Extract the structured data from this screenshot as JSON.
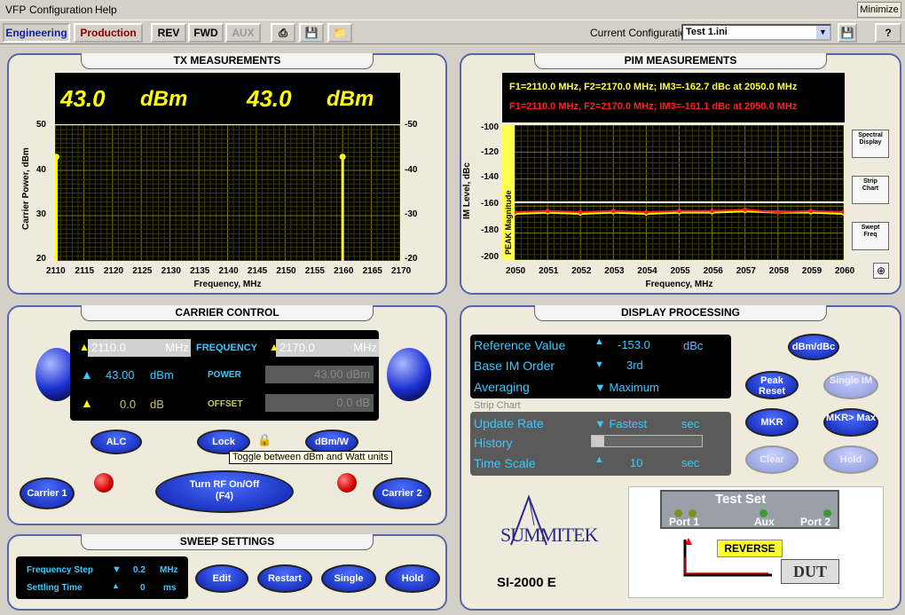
{
  "menu": {
    "items": [
      "VFP",
      "Configuration",
      "Help"
    ],
    "minimize": "Minimize"
  },
  "toolbar": {
    "engineering": "Engineering",
    "production": "Production",
    "rev": "REV",
    "fwd": "FWD",
    "aux": "AUX",
    "config_label": "Current Configuration:",
    "config_value": "Test 1.ini",
    "help": "?"
  },
  "tx": {
    "title": "TX MEASUREMENTS",
    "readout_left_value": "43.0",
    "readout_left_unit": "dBm",
    "readout_right_value": "43.0",
    "readout_right_unit": "dBm",
    "ylabel": "Carrier Power, dBm",
    "xlabel": "Frequency, MHz",
    "yticks": [
      "50",
      "40",
      "30",
      "20"
    ],
    "yticks_right": [
      "-50",
      "-40",
      "-30",
      "-20"
    ],
    "xticks": [
      "2110",
      "2115",
      "2120",
      "2125",
      "2130",
      "2135",
      "2140",
      "2145",
      "2150",
      "2155",
      "2160",
      "2165",
      "2170"
    ]
  },
  "pim": {
    "title": "PIM MEASUREMENTS",
    "line1": "F1=2110.0 MHz, F2=2170.0 MHz;  IM3=-162.7 dBc at 2050.0 MHz",
    "line2": "F1=2110.0 MHz, F2=2170.0 MHz;  IM3=-161.1 dBc at 2050.0 MHz",
    "ylabel": "IM Level, dBc",
    "xlabel": "Frequency, MHz",
    "peak_label": "PEAK Magnitude",
    "yticks": [
      "-100",
      "-120",
      "-140",
      "-160",
      "-180",
      "-200"
    ],
    "xticks": [
      "2050",
      "2051",
      "2052",
      "2053",
      "2054",
      "2055",
      "2056",
      "2057",
      "2058",
      "2059",
      "2060"
    ],
    "modes": [
      "Spectral Display",
      "Strip Chart",
      "Swept Freq"
    ]
  },
  "chart_data": [
    {
      "type": "bar",
      "title": "TX MEASUREMENTS",
      "xlabel": "Frequency, MHz",
      "ylabel": "Carrier Power, dBm",
      "x": [
        2110,
        2160
      ],
      "values": [
        43.0,
        43.0
      ],
      "xlim": [
        2110,
        2170
      ],
      "ylim": [
        20,
        50
      ],
      "grid": true
    },
    {
      "type": "line",
      "title": "PIM MEASUREMENTS",
      "xlabel": "Frequency, MHz",
      "ylabel": "IM Level, dBc",
      "xlim": [
        2050,
        2060
      ],
      "ylim": [
        -200,
        -90
      ],
      "grid": true,
      "series": [
        {
          "color": "#ffff00",
          "x": [
            2050,
            2051,
            2052,
            2053,
            2054,
            2055,
            2056,
            2057,
            2058,
            2059,
            2060
          ],
          "values": [
            -162,
            -161,
            -162,
            -161,
            -162,
            -161,
            -161,
            -160,
            -161,
            -161,
            -162
          ]
        },
        {
          "color": "#ff2020",
          "x": [
            2050,
            2051,
            2052,
            2053,
            2054,
            2055,
            2056,
            2057,
            2058,
            2059,
            2060
          ],
          "values": [
            -161,
            -160,
            -161,
            -160,
            -161,
            -160,
            -160,
            -159,
            -161,
            -160,
            -161
          ]
        }
      ]
    }
  ],
  "carrier": {
    "title": "CARRIER CONTROL",
    "f1": "2110.0",
    "f2": "2170.0",
    "mhz": "MHz",
    "frequency": "FREQUENCY",
    "p1": "43.00",
    "p2": "43.00",
    "dbm": "dBm",
    "power": "POWER",
    "o1": "0.0",
    "o2": "0.0",
    "db": "dB",
    "offset": "OFFSET",
    "alc": "ALC",
    "lock": "Lock",
    "dbmw": "dBm/W",
    "tooltip": "Toggle between dBm and Watt units",
    "carrier1": "Carrier 1",
    "carrier2": "Carrier 2",
    "rf1": "Turn RF On/Off",
    "rf2": "(F4)"
  },
  "sweep": {
    "title": "SWEEP SETTINGS",
    "step_label": "Frequency Step",
    "step_value": "0.2",
    "step_unit": "MHz",
    "settle_label": "Settling Time",
    "settle_value": "0",
    "settle_unit": "ms",
    "edit": "Edit",
    "restart": "Restart",
    "single": "Single",
    "hold": "Hold"
  },
  "display": {
    "title": "DISPLAY PROCESSING",
    "ref_label": "Reference Value",
    "ref_value": "-153.0",
    "ref_unit": "dBc",
    "order_label": "Base IM Order",
    "order_value": "3rd",
    "avg_label": "Averaging",
    "avg_value": "Maximum",
    "strip": "Strip Chart",
    "rate_label": "Update Rate",
    "rate_value": "Fastest",
    "rate_unit": "sec",
    "history_label": "History",
    "timescale_label": "Time Scale",
    "timescale_value": "10",
    "timescale_unit": "sec",
    "dbm_dbc": "dBm/dBc",
    "peak_reset": "Peak Reset",
    "single_im": "Single IM",
    "mkr": "MKR",
    "mkr_max": "MKR> Max",
    "clear": "Clear",
    "hold": "Hold"
  },
  "testset": {
    "brand": "SUMMITEK",
    "model": "SI-2000 E",
    "title": "Test Set",
    "port1": "Port 1",
    "aux": "Aux",
    "port2": "Port 2",
    "reverse": "REVERSE",
    "dut": "DUT"
  }
}
